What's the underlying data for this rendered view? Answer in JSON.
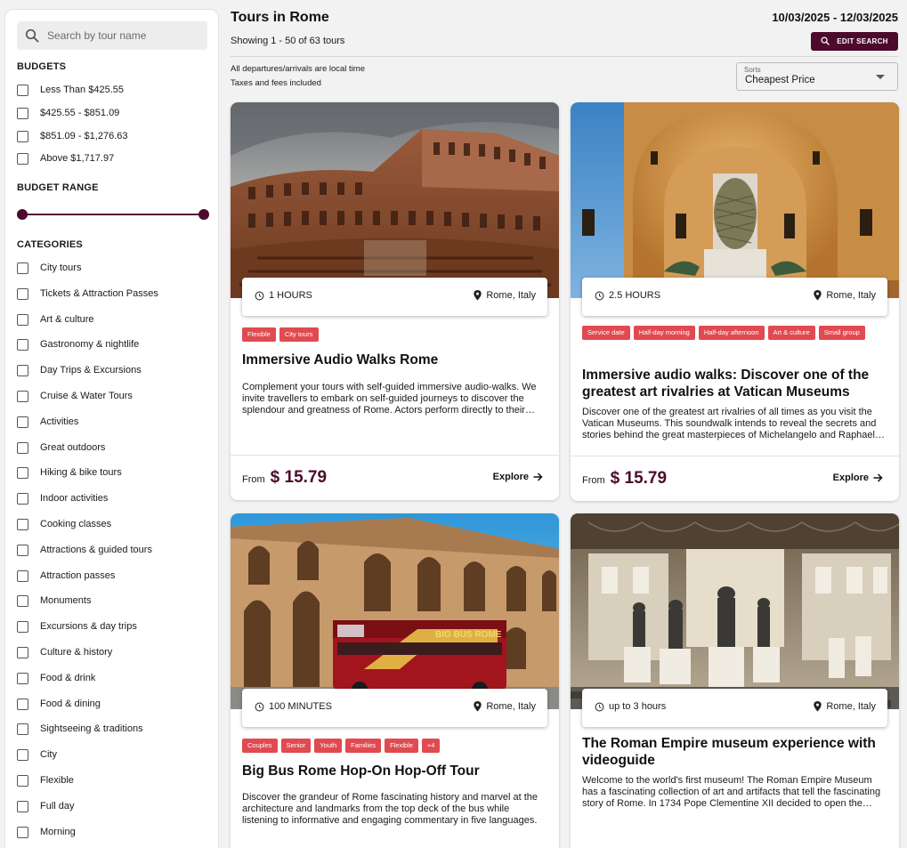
{
  "sidebar": {
    "search_placeholder": "Search by tour name",
    "budgets": {
      "title": "BUDGETS",
      "options": [
        "Less Than $425.55",
        "$425.55 - $851.09",
        "$851.09 - $1,276.63",
        "Above $1,717.97"
      ]
    },
    "budget_range": {
      "title": "BUDGET RANGE",
      "min_fraction": 0,
      "max_fraction": 1
    },
    "categories": {
      "title": "CATEGORIES",
      "options": [
        "City tours",
        "Tickets & Attraction Passes",
        "Art & culture",
        "Gastronomy & nightlife",
        "Day Trips & Excursions",
        "Cruise & Water Tours",
        "Activities",
        "Great outdoors",
        "Hiking & bike tours",
        "Indoor activities",
        "Cooking classes",
        "Attractions & guided tours",
        "Attraction passes",
        "Monuments",
        "Excursions & day trips",
        "Culture & history",
        "Food & drink",
        "Food & dining",
        "Sightseeing & traditions",
        "City",
        "Flexible",
        "Full day",
        "Morning"
      ]
    }
  },
  "header": {
    "title": "Tours in Rome",
    "date_range": "10/03/2025 - 12/03/2025",
    "showing": "Showing 1 - 50 of 63 tours",
    "edit_search": "EDIT SEARCH",
    "info_line_1": "All departures/arrivals are local time",
    "info_line_2": "Taxes and fees included",
    "sort_label": "Sorts",
    "sort_value": "Cheapest Price"
  },
  "colors": {
    "primary": "#4c0a2c",
    "tag": "#e04a50"
  },
  "tours": [
    {
      "duration": "1 HOURS",
      "location": "Rome, Italy",
      "tags": [
        "Flexible",
        "City tours"
      ],
      "title": "Immersive Audio Walks Rome",
      "description": "Complement your tours with self-guided immersive audio-walks. We invite travellers to embark on self-guided journeys to discover the splendour and greatness of Rome. Actors perform directly to their ears.",
      "price_prefix": "From",
      "price": "$ 15.79",
      "cta": "Explore"
    },
    {
      "duration": "2.5 HOURS",
      "location": "Rome, Italy",
      "tags": [
        "Service date",
        "Half-day morning",
        "Half-day afternoon",
        "Art & culture",
        "Small group"
      ],
      "title": "Immersive audio walks: Discover one of the greatest art rivalries at Vatican Museums",
      "description": "Discover one of the greatest art rivalries of all times as you visit the Vatican Museums. This soundwalk intends to reveal the secrets and stories behind the great masterpieces of Michelangelo and Raphael in the Vatican.",
      "price_prefix": "From",
      "price": "$ 15.79",
      "cta": "Explore"
    },
    {
      "duration": "100 MINUTES",
      "location": "Rome, Italy",
      "tags": [
        "Couples",
        "Senior",
        "Youth",
        "Families",
        "Flexible",
        "+4"
      ],
      "title": "Big Bus Rome Hop-On Hop-Off Tour",
      "description": "Discover the grandeur of Rome fascinating history and marvel at the architecture and landmarks from the top deck of the bus while listening to informative and engaging commentary in five languages.",
      "image_text": "BIG BUS ROME"
    },
    {
      "duration": "up to 3 hours",
      "location": "Rome, Italy",
      "tags": [],
      "title": "The Roman Empire museum experience with videoguide",
      "description": "Welcome to the world's first museum! The Roman Empire Museum has a fascinating collection of art and artifacts that tell the fascinating story of Rome. In 1734 Pope Clementine XII decided to open the museum."
    }
  ]
}
